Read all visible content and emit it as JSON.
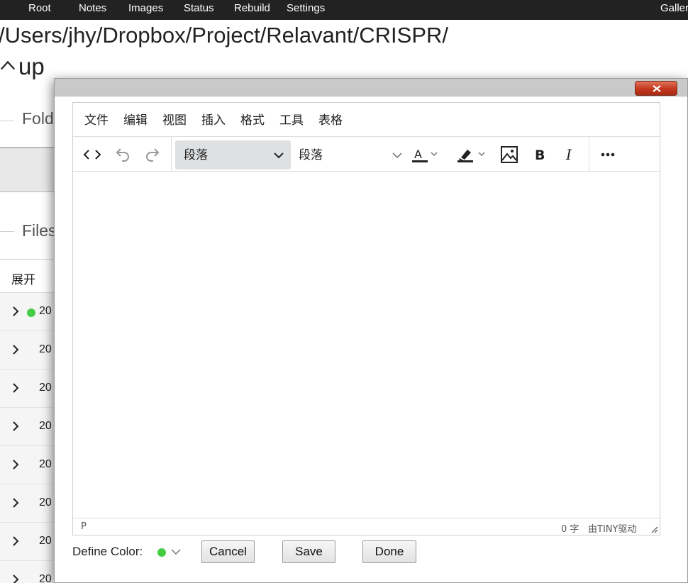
{
  "navbar": {
    "items": [
      "Root",
      "Notes",
      "Images",
      "Status",
      "Rebuild",
      "Settings"
    ],
    "right_item": "Galler"
  },
  "page": {
    "path": "/Users/jhy/Dropbox/Project/Relavant/CRISPR/",
    "up_label": "up",
    "folders_label": "Fold",
    "files_label": "Files",
    "column_header": "展开",
    "row_text": "20",
    "row_count": 8
  },
  "editor": {
    "menu": [
      "文件",
      "编辑",
      "视图",
      "插入",
      "格式",
      "工具",
      "表格"
    ],
    "block_format": "段落",
    "font_format": "段落",
    "toolbar_icons": [
      "source-code-icon",
      "undo-icon",
      "redo-icon",
      "text-color-icon",
      "highlight-icon",
      "image-icon",
      "bold-icon",
      "italic-icon",
      "more-icon"
    ],
    "status_path": "P",
    "word_count": "0 字",
    "branding": "由TINY驱动"
  },
  "footer": {
    "define_color_label": "Define Color:",
    "cancel_label": "Cancel",
    "save_label": "Save",
    "done_label": "Done"
  },
  "colors": {
    "navbar_bg": "#222222",
    "status_green": "#44cc44",
    "close_button": "#c2371c",
    "select_bg": "#dee0e2"
  }
}
